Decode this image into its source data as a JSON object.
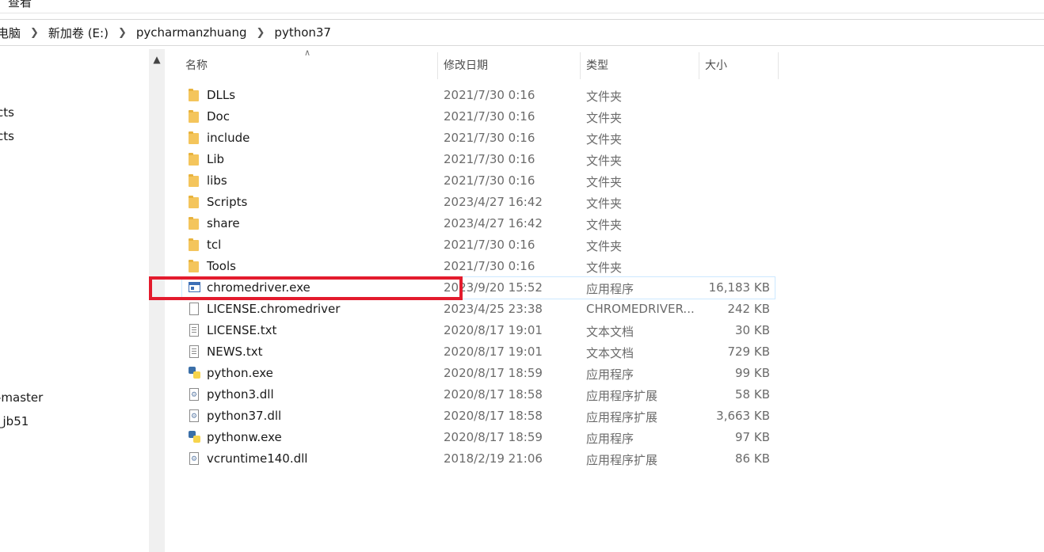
{
  "ribbon": {
    "view_tab": "查看"
  },
  "breadcrumb": [
    "电脑",
    "新加卷 (E:)",
    "pycharmanzhuang",
    "python37"
  ],
  "nav": {
    "items": [
      "cts",
      "cts",
      "-master",
      "_jb51"
    ]
  },
  "columns": {
    "name": "名称",
    "date": "修改日期",
    "type": "类型",
    "size": "大小"
  },
  "files": [
    {
      "name": "DLLs",
      "date": "2021/7/30 0:16",
      "type": "文件夹",
      "size": "",
      "icon": "folder-icon"
    },
    {
      "name": "Doc",
      "date": "2021/7/30 0:16",
      "type": "文件夹",
      "size": "",
      "icon": "folder-icon"
    },
    {
      "name": "include",
      "date": "2021/7/30 0:16",
      "type": "文件夹",
      "size": "",
      "icon": "folder-icon"
    },
    {
      "name": "Lib",
      "date": "2021/7/30 0:16",
      "type": "文件夹",
      "size": "",
      "icon": "folder-icon"
    },
    {
      "name": "libs",
      "date": "2021/7/30 0:16",
      "type": "文件夹",
      "size": "",
      "icon": "folder-icon"
    },
    {
      "name": "Scripts",
      "date": "2023/4/27 16:42",
      "type": "文件夹",
      "size": "",
      "icon": "folder-icon"
    },
    {
      "name": "share",
      "date": "2023/4/27 16:42",
      "type": "文件夹",
      "size": "",
      "icon": "folder-icon"
    },
    {
      "name": "tcl",
      "date": "2021/7/30 0:16",
      "type": "文件夹",
      "size": "",
      "icon": "folder-icon"
    },
    {
      "name": "Tools",
      "date": "2021/7/30 0:16",
      "type": "文件夹",
      "size": "",
      "icon": "folder-icon"
    },
    {
      "name": "chromedriver.exe",
      "date": "2023/9/20 15:52",
      "type": "应用程序",
      "size": "16,183 KB",
      "icon": "exe-icon"
    },
    {
      "name": "LICENSE.chromedriver",
      "date": "2023/4/25 23:38",
      "type": "CHROMEDRIVER...",
      "size": "242 KB",
      "icon": "file-icon"
    },
    {
      "name": "LICENSE.txt",
      "date": "2020/8/17 19:01",
      "type": "文本文档",
      "size": "30 KB",
      "icon": "text-file-icon"
    },
    {
      "name": "NEWS.txt",
      "date": "2020/8/17 19:01",
      "type": "文本文档",
      "size": "729 KB",
      "icon": "text-file-icon"
    },
    {
      "name": "python.exe",
      "date": "2020/8/17 18:59",
      "type": "应用程序",
      "size": "99 KB",
      "icon": "python-icon"
    },
    {
      "name": "python3.dll",
      "date": "2020/8/17 18:58",
      "type": "应用程序扩展",
      "size": "58 KB",
      "icon": "dll-icon"
    },
    {
      "name": "python37.dll",
      "date": "2020/8/17 18:58",
      "type": "应用程序扩展",
      "size": "3,663 KB",
      "icon": "dll-icon"
    },
    {
      "name": "pythonw.exe",
      "date": "2020/8/17 18:59",
      "type": "应用程序",
      "size": "97 KB",
      "icon": "python-icon"
    },
    {
      "name": "vcruntime140.dll",
      "date": "2018/2/19 21:06",
      "type": "应用程序扩展",
      "size": "86 KB",
      "icon": "dll-icon"
    }
  ],
  "highlight_color": "#e31b2d"
}
